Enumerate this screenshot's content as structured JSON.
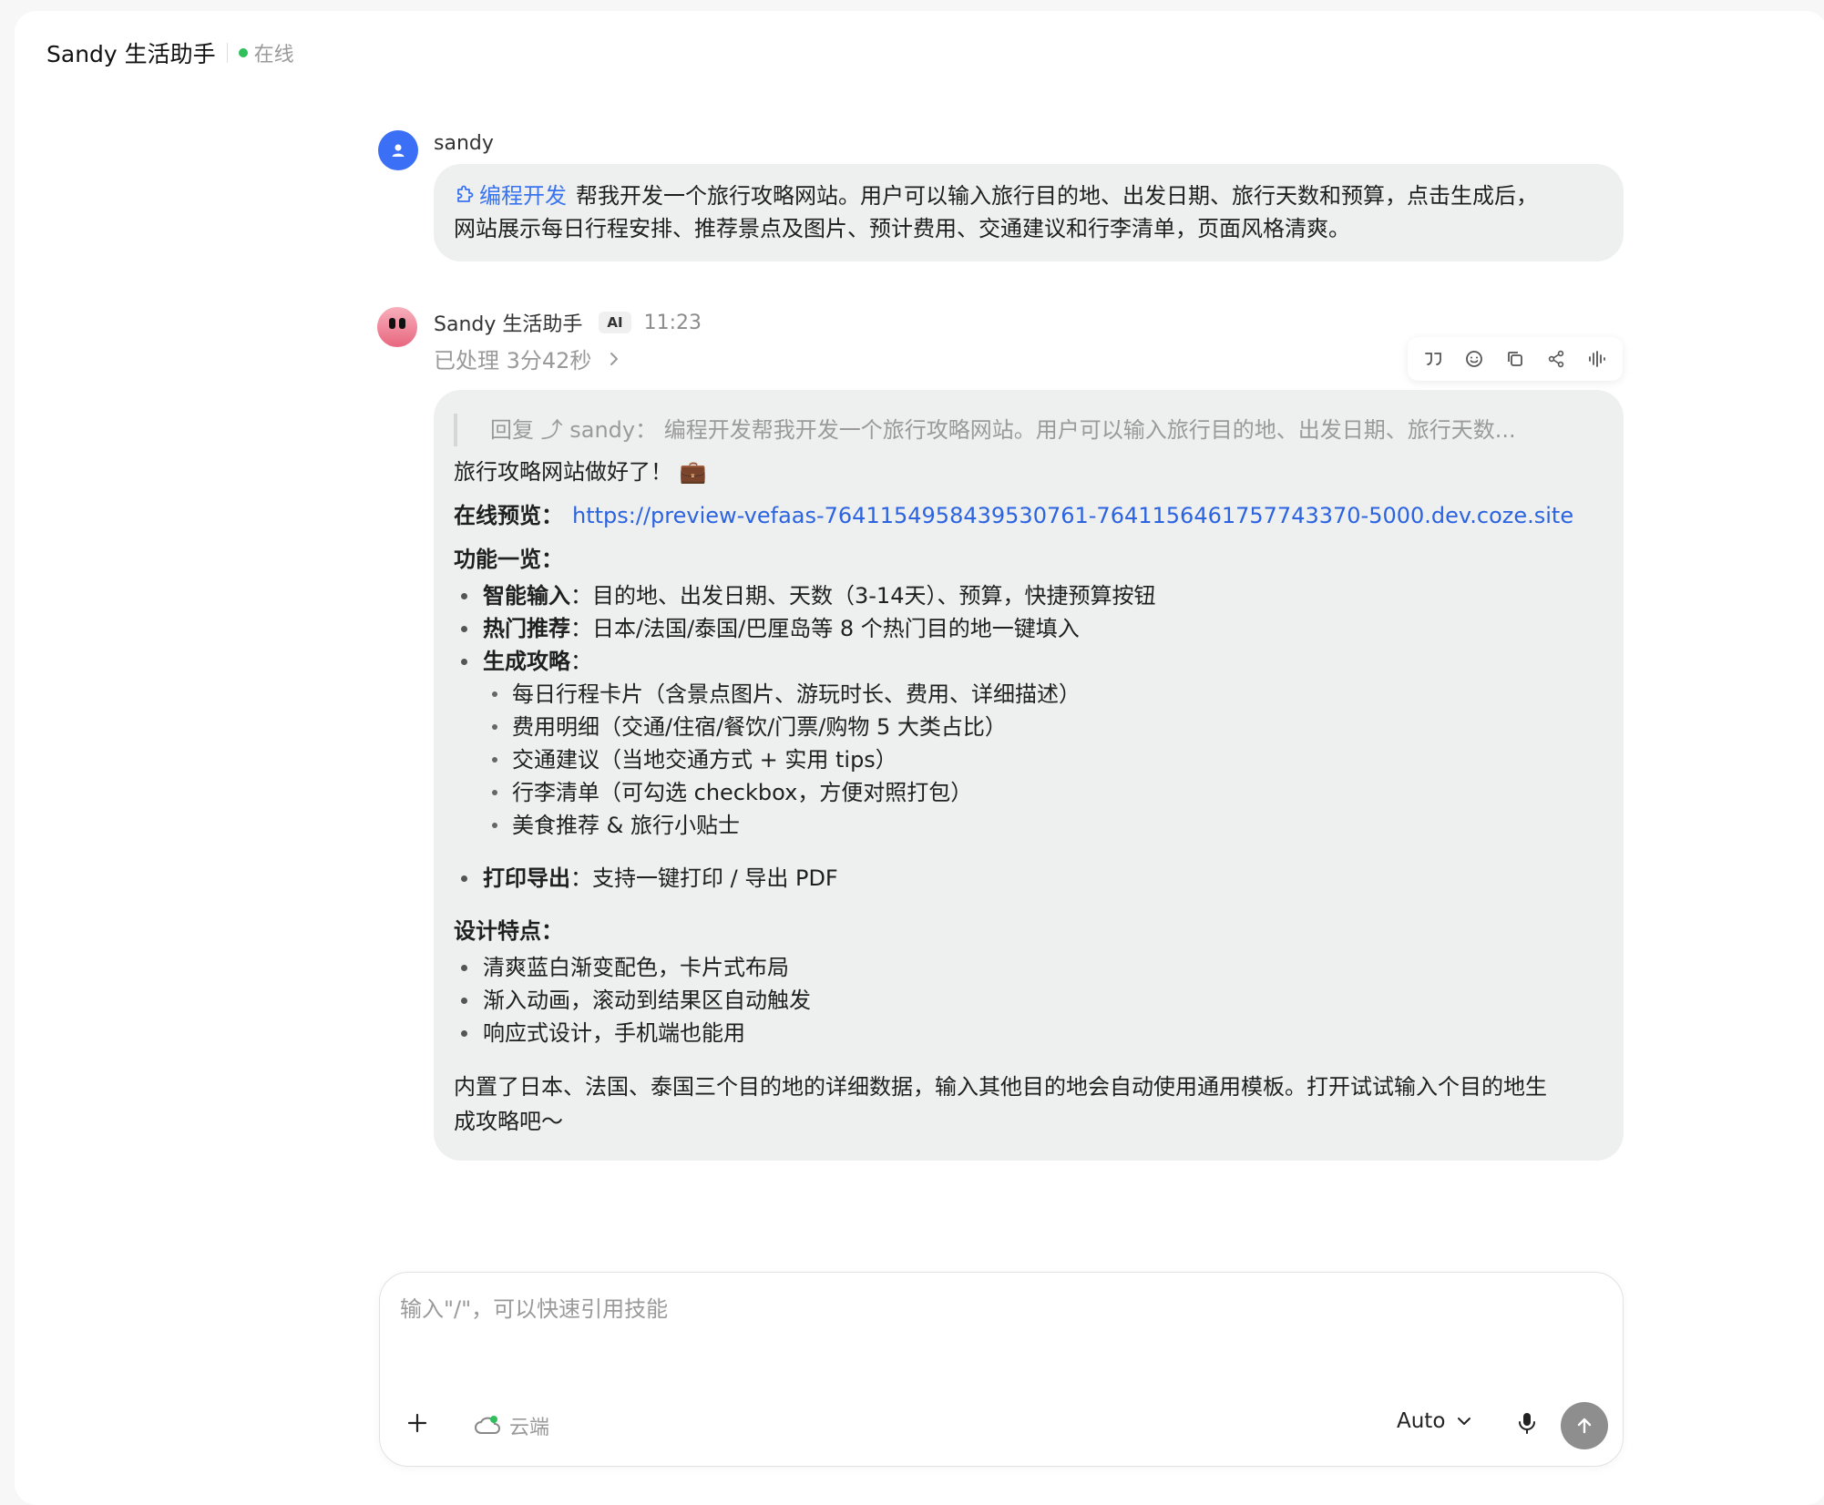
{
  "header": {
    "title": "Sandy 生活助手",
    "status": "在线",
    "status_color": "#2fbf5b"
  },
  "user_message": {
    "name": "sandy",
    "skill_tag": "编程开发",
    "line1": "帮我开发一个旅行攻略网站。用户可以输入旅行目的地、出发日期、旅行天数和预算，点击生成后，",
    "line2": "网站展示每日行程安排、推荐景点及图片、预计费用、交通建议和行李清单，页面风格清爽。"
  },
  "bot_message": {
    "name": "Sandy 生活助手",
    "badge": "AI",
    "time": "11:23",
    "processed": "已处理 3分42秒",
    "actions": [
      "quote-icon",
      "emoji-icon",
      "copy-icon",
      "share-icon",
      "voice-icon"
    ],
    "quote": "回复 ⤴ sandy：  编程开发帮我开发一个旅行攻略网站。用户可以输入旅行目的地、出发日期、旅行天数...",
    "done_text": "旅行攻略网站做好了！ 💼",
    "preview_label": "在线预览：",
    "preview_url": "https://preview-vefaas-7641154958439530761-7641156461757743370-5000.dev.coze.site",
    "features_heading": "功能一览：",
    "features": [
      {
        "label": "智能输入",
        "text": "：目的地、出发日期、天数（3-14天）、预算，快捷预算按钮"
      },
      {
        "label": "热门推荐",
        "text": "：日本/法国/泰国/巴厘岛等 8 个热门目的地一键填入"
      },
      {
        "label": "生成攻略",
        "text": "："
      }
    ],
    "sub_features": [
      "每日行程卡片（含景点图片、游玩时长、费用、详细描述）",
      "费用明细（交通/住宿/餐饮/门票/购物 5 大类占比）",
      "交通建议（当地交通方式 + 实用 tips）",
      "行李清单（可勾选 checkbox，方便对照打包）",
      "美食推荐 & 旅行小贴士"
    ],
    "export_feature": {
      "label": "打印导出",
      "text": "：支持一键打印 / 导出 PDF"
    },
    "design_heading": "设计特点：",
    "design_points": [
      "清爽蓝白渐变配色，卡片式布局",
      "渐入动画，滚动到结果区自动触发",
      "响应式设计，手机端也能用"
    ],
    "closing_line1": "内置了日本、法国、泰国三个目的地的详细数据，输入其他目的地会自动使用通用模板。打开试试输入个目的地生",
    "closing_line2": "成攻略吧～"
  },
  "composer": {
    "placeholder": "输入\"/\"，可以快速引用技能",
    "cloud_label": "云端",
    "model": "Auto",
    "accent": "#3a73f0"
  }
}
